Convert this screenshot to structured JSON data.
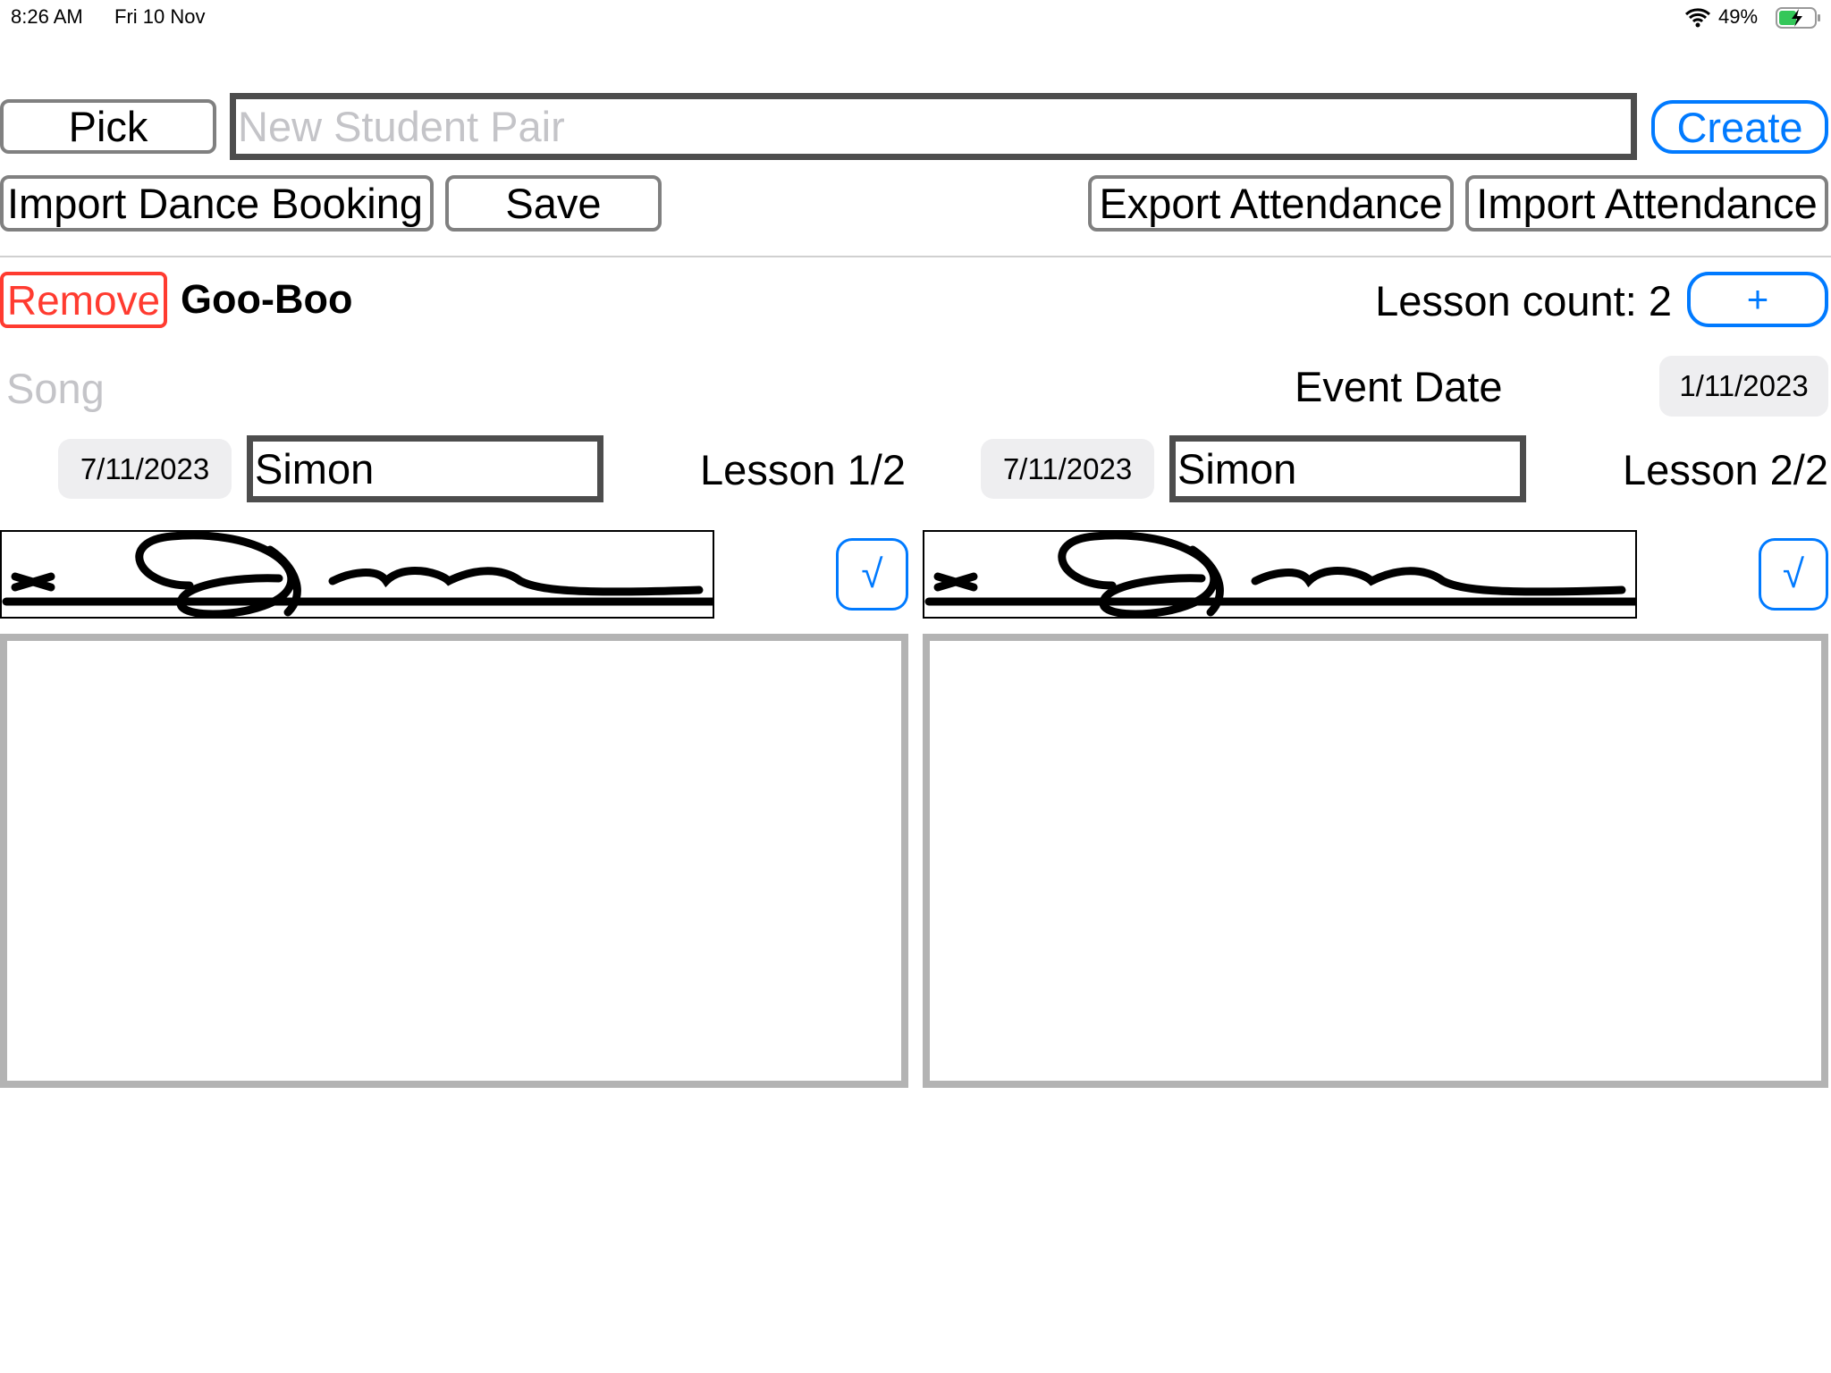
{
  "status_bar": {
    "time": "8:26 AM",
    "date": "Fri 10 Nov",
    "battery": "49%",
    "battery_level": 49,
    "icons": [
      "wifi-icon",
      "battery-charging-icon"
    ]
  },
  "toolbar": {
    "pick_label": "Pick",
    "student_pair_placeholder": "New Student Pair",
    "student_pair_value": "",
    "create_label": "Create",
    "import_booking_label": "Import Dance Booking",
    "save_label": "Save",
    "export_attendance_label": "Export Attendance",
    "import_attendance_label": "Import Attendance"
  },
  "pair": {
    "remove_label": "Remove",
    "name": "Goo-Boo",
    "lesson_count": "Lesson count: 2",
    "add_label": "+",
    "song_placeholder": "Song",
    "event_date_label": "Event Date",
    "event_date": "1/11/2023"
  },
  "lessons": [
    {
      "date": "7/11/2023",
      "teacher": "Simon",
      "label": "Lesson 1/2",
      "confirm_label": "√"
    },
    {
      "date": "7/11/2023",
      "teacher": "Simon",
      "label": "Lesson 2/2",
      "confirm_label": "√"
    }
  ],
  "colors": {
    "accent": "#007aff",
    "destructive": "#ff3b30",
    "border": "#808080",
    "pad_border": "#b3b3b3"
  }
}
